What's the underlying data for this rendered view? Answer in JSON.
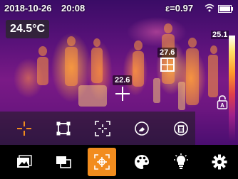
{
  "status": {
    "date": "2018-10-26",
    "time": "20:08",
    "emissivity": "ε=0.97"
  },
  "center_temperature": "24.5°C",
  "points": [
    {
      "value": "27.6"
    },
    {
      "value": "22.6"
    }
  ],
  "colorbar": {
    "max_label": "25.1",
    "palette": [
      "#ffffff",
      "#ffe066",
      "#ff9a2a",
      "#e0404a",
      "#a0208a",
      "#4a0e70"
    ]
  },
  "sub_toolbar": {
    "items": [
      {
        "name": "point-tool",
        "icon": "crosshair-icon",
        "active": true
      },
      {
        "name": "area-tool",
        "icon": "box-icon",
        "active": false
      },
      {
        "name": "center-point-tool",
        "icon": "target-icon",
        "active": false
      },
      {
        "name": "clear-tool",
        "icon": "eraser-icon",
        "active": false
      },
      {
        "name": "delete-tool",
        "icon": "trash-icon",
        "active": false
      }
    ]
  },
  "main_toolbar": {
    "items": [
      {
        "name": "gallery",
        "icon": "image-icon",
        "active": false
      },
      {
        "name": "fusion",
        "icon": "overlay-icon",
        "active": false
      },
      {
        "name": "measure",
        "icon": "measure-icon",
        "active": true
      },
      {
        "name": "palette",
        "icon": "palette-icon",
        "active": false
      },
      {
        "name": "brightness",
        "icon": "bulb-icon",
        "active": false
      },
      {
        "name": "settings",
        "icon": "gear-icon",
        "active": false
      }
    ]
  },
  "colors": {
    "accent": "#f28c1e"
  }
}
